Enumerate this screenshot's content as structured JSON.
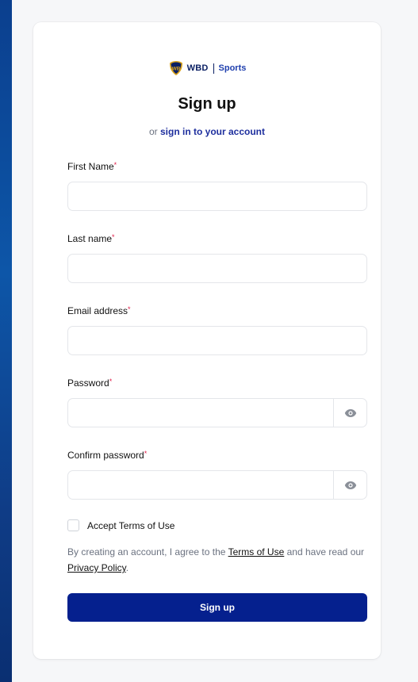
{
  "brand": {
    "wbd": "WBD",
    "sports": "Sports"
  },
  "title": "Sign up",
  "subtitle": {
    "prefix": "or",
    "link": "sign in to your account"
  },
  "fields": {
    "first_name": {
      "label": "First Name",
      "value": "",
      "placeholder": ""
    },
    "last_name": {
      "label": "Last name",
      "value": "",
      "placeholder": ""
    },
    "email": {
      "label": "Email address",
      "value": "",
      "placeholder": ""
    },
    "password": {
      "label": "Password",
      "value": "",
      "placeholder": "",
      "toggle_icon": "eye-icon"
    },
    "confirm_password": {
      "label": "Confirm password",
      "value": "",
      "placeholder": "",
      "toggle_icon": "eye-icon"
    }
  },
  "required_marker": "*",
  "terms": {
    "checkbox_label": "Accept Terms of Use",
    "checked": false,
    "legal_prefix": "By creating an account, I agree to the",
    "terms_link": "Terms of Use",
    "legal_middle": "and have read our",
    "privacy_link": "Privacy Policy",
    "legal_suffix": "."
  },
  "submit_label": "Sign up",
  "colors": {
    "primary_button": "#05208e",
    "link": "#1e2f9e",
    "required": "#e11d48",
    "brand_shield": "#d9a21b",
    "background_strip": "#0d56a8"
  }
}
